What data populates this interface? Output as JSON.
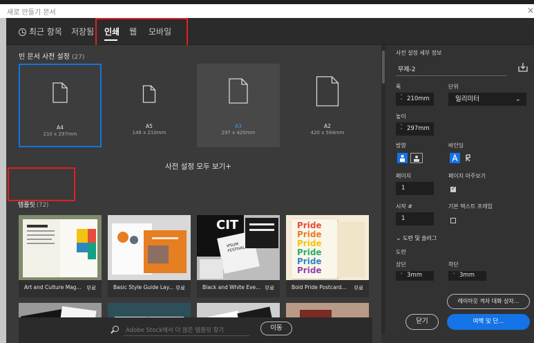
{
  "window": {
    "title": "새로 만들기 문서",
    "close_glyph": "×"
  },
  "tabs": [
    {
      "label": "최근 항목",
      "active": false
    },
    {
      "label": "저장됨",
      "active": false
    },
    {
      "label": "인쇄",
      "active": true
    },
    {
      "label": "웹",
      "active": false
    },
    {
      "label": "모바일",
      "active": false
    }
  ],
  "blank_presets": {
    "title": "빈 문서 사전 설정",
    "count": "(27)",
    "items": [
      {
        "name": "A4",
        "size": "210 x 297mm",
        "state": "selected"
      },
      {
        "name": "A5",
        "size": "148 x 210mm",
        "state": "normal"
      },
      {
        "name": "A3",
        "size": "297 x 420mm",
        "state": "hover"
      },
      {
        "name": "A2",
        "size": "420 x 594mm",
        "state": "normal"
      }
    ],
    "see_all": "사전 설정 모두 보기+"
  },
  "templates": {
    "title": "템플릿",
    "count": "(72)",
    "items": [
      {
        "name": "Art and Culture Mag...",
        "price": "무료"
      },
      {
        "name": "Basic Style Guide Lay...",
        "price": "무료"
      },
      {
        "name": "Black and White Eve...",
        "price": "무료"
      },
      {
        "name": "Bold Pride Postcard...",
        "price": "무료"
      }
    ],
    "thumb_text": {
      "cit": "CIT",
      "festival": "IPSUM\nFESTIVAL",
      "pride": "Pride"
    }
  },
  "search": {
    "placeholder": "Adobe Stock에서 더 많은 템플릿 찾기",
    "go_label": "이동"
  },
  "details": {
    "header": "사전 설정 세부 정보",
    "doc_name": "무제-2",
    "width_label": "폭",
    "width_value": "210mm",
    "units_label": "단위",
    "units_value": "밀리미터",
    "height_label": "높이",
    "height_value": "297mm",
    "orientation_label": "방향",
    "binding_label": "바인딩",
    "pages_label": "페이지",
    "pages_value": "1",
    "facing_label": "페이지 마주보기",
    "facing_checked": true,
    "start_label": "시작 #",
    "start_value": "1",
    "primary_text_label": "기본 텍스트 프레임",
    "primary_text_checked": false,
    "bleed_section": "도련 및 슬러그",
    "bleed_label": "도련",
    "top_label": "상단",
    "top_value": "3mm",
    "bottom_label": "하단",
    "bottom_value": "3mm"
  },
  "buttons": {
    "layout_grid": "레이아웃 격자 대화 상자...",
    "close": "닫기",
    "margins": "여백 및 단..."
  },
  "colors": {
    "accent": "#1473e6",
    "highlight_box": "#e01f26"
  }
}
